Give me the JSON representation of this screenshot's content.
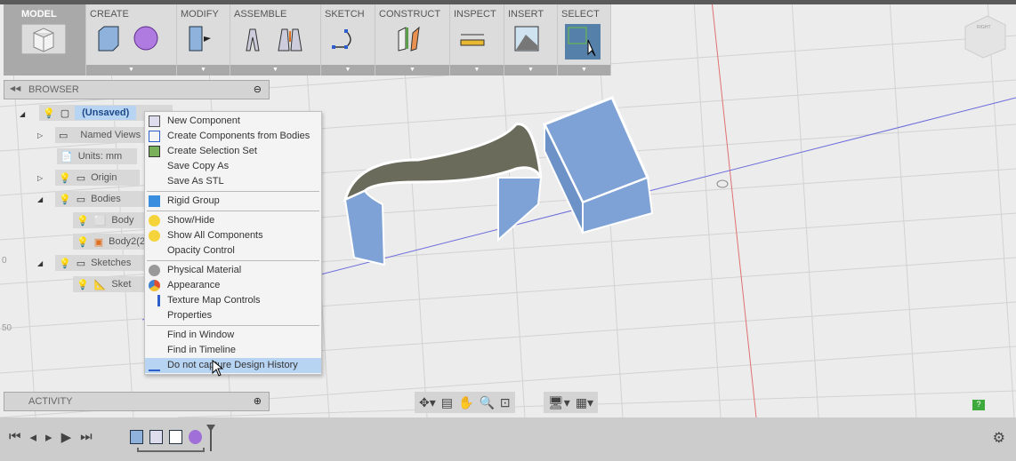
{
  "toolbar": {
    "groups": [
      {
        "label": "MODEL"
      },
      {
        "label": "CREATE"
      },
      {
        "label": "MODIFY"
      },
      {
        "label": "ASSEMBLE"
      },
      {
        "label": "SKETCH"
      },
      {
        "label": "CONSTRUCT"
      },
      {
        "label": "INSPECT"
      },
      {
        "label": "INSERT"
      },
      {
        "label": "SELECT"
      }
    ]
  },
  "viewcube": {
    "label": "RIGHT"
  },
  "browser": {
    "title": "BROWSER",
    "items": [
      {
        "label": "(Unsaved)"
      },
      {
        "label": "Named Views"
      },
      {
        "label": "Units: mm"
      },
      {
        "label": "Origin"
      },
      {
        "label": "Bodies"
      },
      {
        "label": "Body"
      },
      {
        "label": "Body2(2)"
      },
      {
        "label": "Sketches"
      },
      {
        "label": "Sket"
      }
    ]
  },
  "context_menu": {
    "items": [
      {
        "label": "New Component"
      },
      {
        "label": "Create Components from Bodies"
      },
      {
        "label": "Create Selection Set"
      },
      {
        "label": "Save Copy As"
      },
      {
        "label": "Save As STL"
      },
      {
        "label": "Rigid Group"
      },
      {
        "label": "Show/Hide"
      },
      {
        "label": "Show All Components"
      },
      {
        "label": "Opacity Control"
      },
      {
        "label": "Physical Material"
      },
      {
        "label": "Appearance"
      },
      {
        "label": "Texture Map Controls"
      },
      {
        "label": "Properties"
      },
      {
        "label": "Find in Window"
      },
      {
        "label": "Find in Timeline"
      },
      {
        "label": "Do not capture Design History"
      }
    ]
  },
  "activity": {
    "title": "ACTIVITY"
  },
  "grid_labels": [
    "0",
    "50"
  ],
  "colors": {
    "accent": "#4f86b5",
    "body": "#7ea2d6",
    "highlight": "#b7d4f3"
  }
}
